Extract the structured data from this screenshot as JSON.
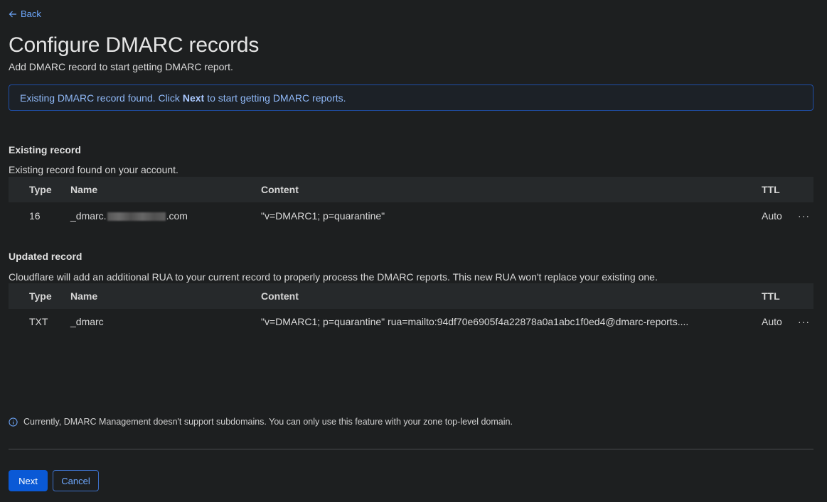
{
  "nav": {
    "back_label": "Back"
  },
  "page": {
    "title": "Configure DMARC records",
    "subtitle": "Add DMARC record to start getting DMARC report."
  },
  "banner": {
    "text_before": "Existing DMARC record found. Click",
    "bold": "Next",
    "text_after": "to start getting DMARC reports."
  },
  "table_headers": {
    "type": "Type",
    "name": "Name",
    "content": "Content",
    "ttl": "TTL"
  },
  "existing": {
    "title": "Existing record",
    "description": "Existing record found on your account.",
    "row": {
      "type": "16",
      "name_prefix": "_dmarc.",
      "name_suffix": ".com",
      "content": "\"v=DMARC1; p=quarantine\"",
      "ttl": "Auto",
      "more": "···"
    }
  },
  "updated": {
    "title": "Updated record",
    "description": "Cloudflare will add an additional RUA to your current record to properly process the DMARC reports. This new RUA won't replace your existing one.",
    "row": {
      "type": "TXT",
      "name": "_dmarc",
      "content": "\"v=DMARC1; p=quarantine\" rua=mailto:94df70e6905f4a22878a0a1abc1f0ed4@dmarc-reports....",
      "ttl": "Auto",
      "more": "···"
    }
  },
  "note": "Currently, DMARC Management doesn't support subdomains. You can only use this feature with your zone top-level domain.",
  "actions": {
    "next_label": "Next",
    "cancel_label": "Cancel"
  },
  "colors": {
    "accent": "#0a59d6",
    "link": "#6ea8fe",
    "background": "#1d1f20",
    "banner_border": "#1f4fa8"
  },
  "icons": {
    "back": "arrow-left-icon",
    "info": "info-circle-icon",
    "more": "more-horizontal-icon"
  }
}
